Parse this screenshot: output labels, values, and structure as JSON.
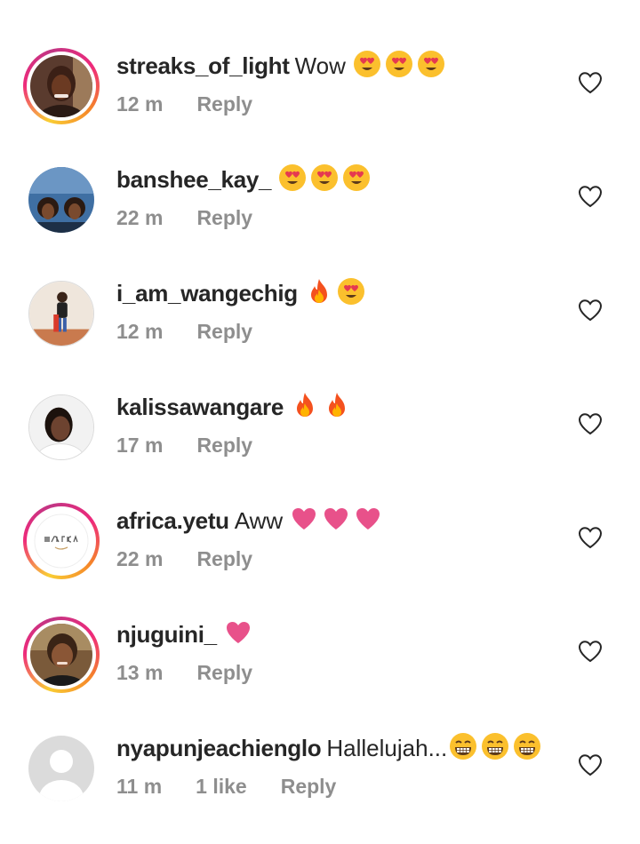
{
  "comments": [
    {
      "username": "streaks_of_light",
      "text": "Wow",
      "emojis": [
        "heart-eyes-emoji",
        "heart-eyes-emoji",
        "heart-eyes-emoji"
      ],
      "time": "12 m",
      "likes": "",
      "reply": "Reply",
      "story_ring": true
    },
    {
      "username": "banshee_kay_",
      "text": "",
      "emojis": [
        "heart-eyes-emoji",
        "heart-eyes-emoji",
        "heart-eyes-emoji"
      ],
      "time": "22 m",
      "likes": "",
      "reply": "Reply",
      "story_ring": false
    },
    {
      "username": "i_am_wangechig",
      "text": "",
      "emojis": [
        "fire-emoji",
        "heart-eyes-emoji"
      ],
      "time": "12 m",
      "likes": "",
      "reply": "Reply",
      "story_ring": false
    },
    {
      "username": "kalissawangare",
      "text": "",
      "emojis": [
        "fire-emoji",
        "fire-emoji"
      ],
      "time": "17 m",
      "likes": "",
      "reply": "Reply",
      "story_ring": false
    },
    {
      "username": "africa.yetu",
      "text": "Aww",
      "emojis": [
        "pink-heart-emoji",
        "pink-heart-emoji",
        "pink-heart-emoji"
      ],
      "time": "22 m",
      "likes": "",
      "reply": "Reply",
      "story_ring": true
    },
    {
      "username": "njuguini_",
      "text": "",
      "emojis": [
        "pink-heart-emoji"
      ],
      "time": "13 m",
      "likes": "",
      "reply": "Reply",
      "story_ring": true
    },
    {
      "username": "nyapunjeachienglo",
      "text": "Hallelujah...",
      "emojis": [
        "grin-emoji",
        "grin-emoji",
        "grin-emoji"
      ],
      "time": "11 m",
      "likes": "1 like",
      "reply": "Reply",
      "story_ring": false
    }
  ],
  "colors": {
    "text": "#262626",
    "muted": "#8e8e8e",
    "heart_pink": "#e8518a",
    "emoji_yellow": "#fbc02d"
  }
}
